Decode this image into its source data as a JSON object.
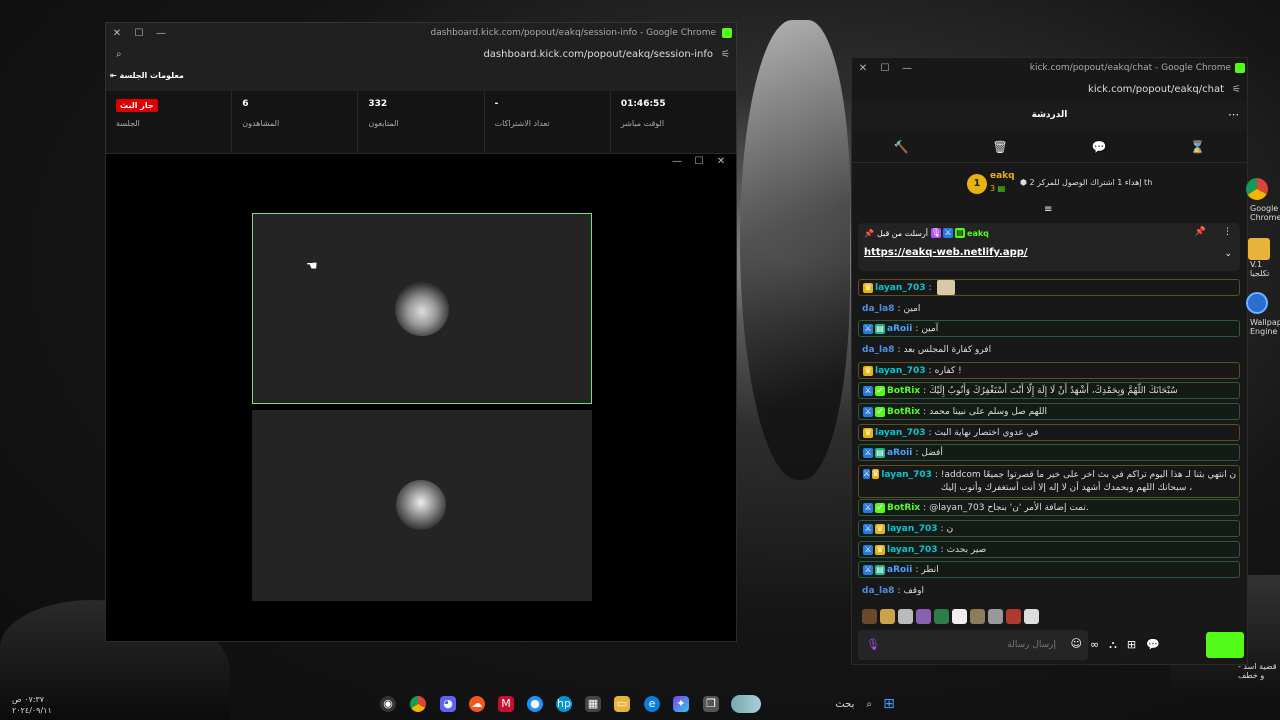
{
  "dashboard_window": {
    "title": "dashboard.kick.com/popout/eakq/session-info - Google Chrome",
    "url": "dashboard.kick.com/popout/eakq/session-info",
    "section_title": "معلومات الجلسة",
    "stats": [
      {
        "value": "جار البث",
        "label": "الجلسة",
        "is_badge": true
      },
      {
        "value": "6",
        "label": "المشاهدون"
      },
      {
        "value": "332",
        "label": "المتابعون"
      },
      {
        "value": "-",
        "label": "تعداد الاشتراكات"
      },
      {
        "value": "01:46:55",
        "label": "الوقت مباشر"
      }
    ]
  },
  "chat_window": {
    "title": "kick.com/popout/eakq/chat - Google Chrome",
    "url": "kick.com/popout/eakq/chat",
    "header": "الدردشة",
    "leaderboard": {
      "rank": "1",
      "username": "eakq",
      "count": "3",
      "gift_text": "إهداء 1 اشتراك الوصول للمركز 2 th"
    },
    "pinned": {
      "label": "أرسلت من قبل",
      "username": "eakq",
      "link": "https://eakq-web.netlify.app/"
    },
    "messages": [
      {
        "user": "layan_703",
        "text": "",
        "color": "#00c8d0",
        "badges": [
          "crown"
        ],
        "style": "hl"
      },
      {
        "user": "da_la8",
        "text": "امين",
        "color": "#4a90e2",
        "badges": [],
        "style": "plain"
      },
      {
        "user": "aRoii",
        "text": "آمين",
        "color": "#4aa0ff",
        "badges": [
          "mod",
          "sub"
        ],
        "style": "box"
      },
      {
        "user": "da_la8",
        "text": "افرو كفارة المجلس بعد",
        "color": "#4a90e2",
        "badges": [],
        "style": "plain"
      },
      {
        "user": "layan_703",
        "text": "كفاره !",
        "color": "#00c8d0",
        "badges": [
          "crown"
        ],
        "style": "hl"
      },
      {
        "user": "BotRix",
        "text": "سُبْحَانَكَ اللَّهُمَّ وَبِحَمْدِكَ، أَشْهَدُ أَنْ لَا إِلَهَ إِلَّا أَنْتَ أَسْتَغْفِرُكَ وَأَتُوبُ إِلَيْكَ",
        "color": "#53fc18",
        "badges": [
          "mod",
          "verified"
        ],
        "style": "box"
      },
      {
        "user": "BotRix",
        "text": "اللهم صل وسلم على نبينا محمد",
        "color": "#53fc18",
        "badges": [
          "mod",
          "verified"
        ],
        "style": "box"
      },
      {
        "user": "layan_703",
        "text": "في عدوي اختصار نهاية البث",
        "color": "#00c8d0",
        "badges": [
          "crown"
        ],
        "style": "hl"
      },
      {
        "user": "aRoii",
        "text": "أفضل",
        "color": "#4aa0ff",
        "badges": [
          "mod",
          "sub"
        ],
        "style": "box"
      },
      {
        "user": "layan_703",
        "text": "!addcom ن انتهي بثنا لـ هذا اليوم تراكم في بث اخر على خير ما قصرتوا جميعًا ، سبحانك اللهم وبحمدك أشهد أن لا إله إلا أنت أستغفرك وأتوب إليك",
        "color": "#00c8d0",
        "badges": [
          "mod",
          "crown"
        ],
        "style": "hl"
      },
      {
        "user": "BotRix",
        "text": "@layan_703 تمت إضافة الأمر 'ن' بنجاح.",
        "color": "#53fc18",
        "badges": [
          "mod",
          "verified"
        ],
        "style": "box"
      },
      {
        "user": "layan_703",
        "text": "ن",
        "color": "#00c8d0",
        "badges": [
          "mod",
          "crown"
        ],
        "style": "box"
      },
      {
        "user": "layan_703",
        "text": "صير بحدث",
        "color": "#00c8d0",
        "badges": [
          "mod",
          "crown"
        ],
        "style": "box"
      },
      {
        "user": "aRoii",
        "text": "انطر",
        "color": "#4aa0ff",
        "badges": [
          "mod",
          "sub"
        ],
        "style": "box"
      },
      {
        "user": "da_la8",
        "text": "اوقف",
        "color": "#4a90e2",
        "badges": [],
        "style": "plain"
      }
    ],
    "input_placeholder": "إرسال رسالة"
  },
  "desktop": {
    "icons": [
      {
        "label": "Google Chrome",
        "icon": "chrome-icon"
      },
      {
        "label": "V.1 تكلجيا",
        "icon": "folder-icon"
      },
      {
        "label": "Wallpaper Engine",
        "icon": "wallpaper-engine-icon"
      }
    ],
    "news": "قضية اسد - و خطف"
  },
  "taskbar": {
    "search_placeholder": "بحث",
    "time": "٠٧:٣٧ ص",
    "date": "٢٠٢٤/٠٩/١١"
  }
}
